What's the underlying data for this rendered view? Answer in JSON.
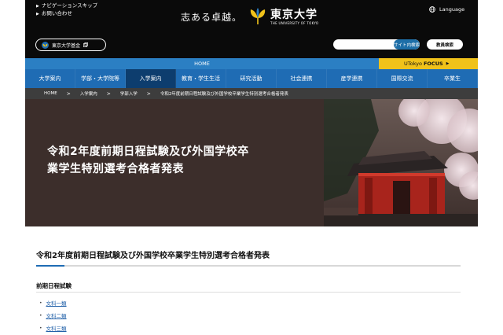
{
  "header": {
    "skip_nav": "ナビゲーションスキップ",
    "contact": "お問い合わせ",
    "slogan": "志ある卓越。",
    "university_name": "東京大学",
    "university_name_en": "THE UNIVERSITY OF TOKYO",
    "language": "Language",
    "fund_button": "東京大学基金",
    "search_button": "サイト内検索",
    "faculty_search_button": "教員検索"
  },
  "home_bar": {
    "label": "HOME"
  },
  "focus_bar": {
    "prefix": "UTokyo",
    "label": "FOCUS"
  },
  "main_nav": {
    "items": [
      {
        "label": "大学案内"
      },
      {
        "label": "学部・大学院等"
      },
      {
        "label": "入学案内"
      },
      {
        "label": "教育・学生生活"
      },
      {
        "label": "研究活動"
      },
      {
        "label": "社会連携"
      },
      {
        "label": "産学連携"
      },
      {
        "label": "国際交流"
      },
      {
        "label": "卒業生"
      }
    ],
    "active_index": 2
  },
  "breadcrumb": {
    "items": [
      {
        "label": "HOME"
      },
      {
        "label": "入学案内"
      },
      {
        "label": "学部入学"
      },
      {
        "label": "令和2年度前期日程試験及び外国学校卒業学生特別選考合格者発表"
      }
    ]
  },
  "hero": {
    "title_line1": "令和2年度前期日程試験及び外国学校卒",
    "title_line2": "業学生特別選考合格者発表"
  },
  "content": {
    "title": "令和2年度前期日程試験及び外国学校卒業学生特別選考合格者発表",
    "section_heading": "前期日程試験",
    "links": [
      {
        "label": "文科一類"
      },
      {
        "label": "文科二類"
      },
      {
        "label": "文科三類"
      }
    ]
  },
  "colors": {
    "header_bg": "#0a0a0a",
    "nav_blue": "#1f6cb4",
    "nav_active": "#0d3d6e",
    "focus_yellow": "#f0c21a",
    "hero_bg": "#3c2e2b"
  }
}
